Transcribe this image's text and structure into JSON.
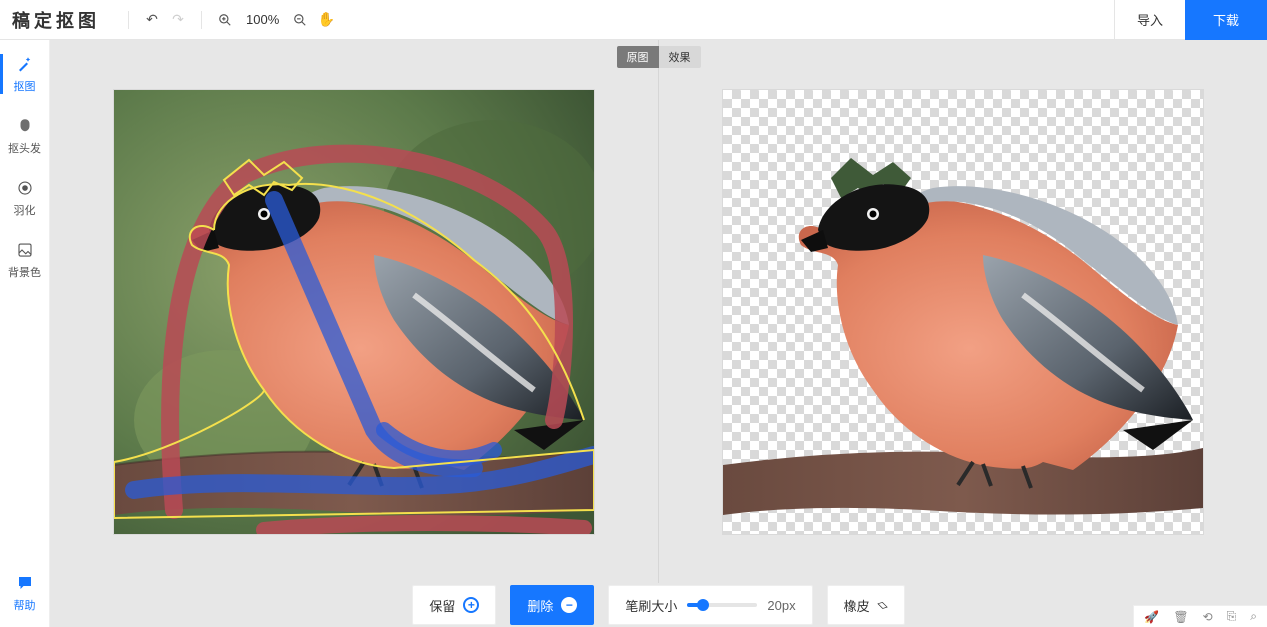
{
  "logo": "稿定抠图",
  "top": {
    "zoom_label": "100%",
    "import_label": "导入",
    "download_label": "下载"
  },
  "rail": {
    "items": [
      {
        "icon": "✨",
        "label": "抠图",
        "active": true
      },
      {
        "icon": "👤",
        "label": "抠头发",
        "active": false
      },
      {
        "icon": "◎",
        "label": "羽化",
        "active": false
      },
      {
        "icon": "▢",
        "label": "背景色",
        "active": false
      }
    ],
    "feedback": {
      "icon": "💬",
      "label": "帮助"
    }
  },
  "tabs": {
    "original": "原图",
    "result": "效果",
    "active": "original"
  },
  "bottom": {
    "keep_label": "保留",
    "remove_label": "删除",
    "brush_label": "笔刷大小",
    "brush_value": "20px",
    "brush_percent": 22,
    "eraser_label": "橡皮"
  },
  "minirail": [
    "�が",
    "🗑",
    "⟲",
    "⎘",
    "⤢"
  ]
}
